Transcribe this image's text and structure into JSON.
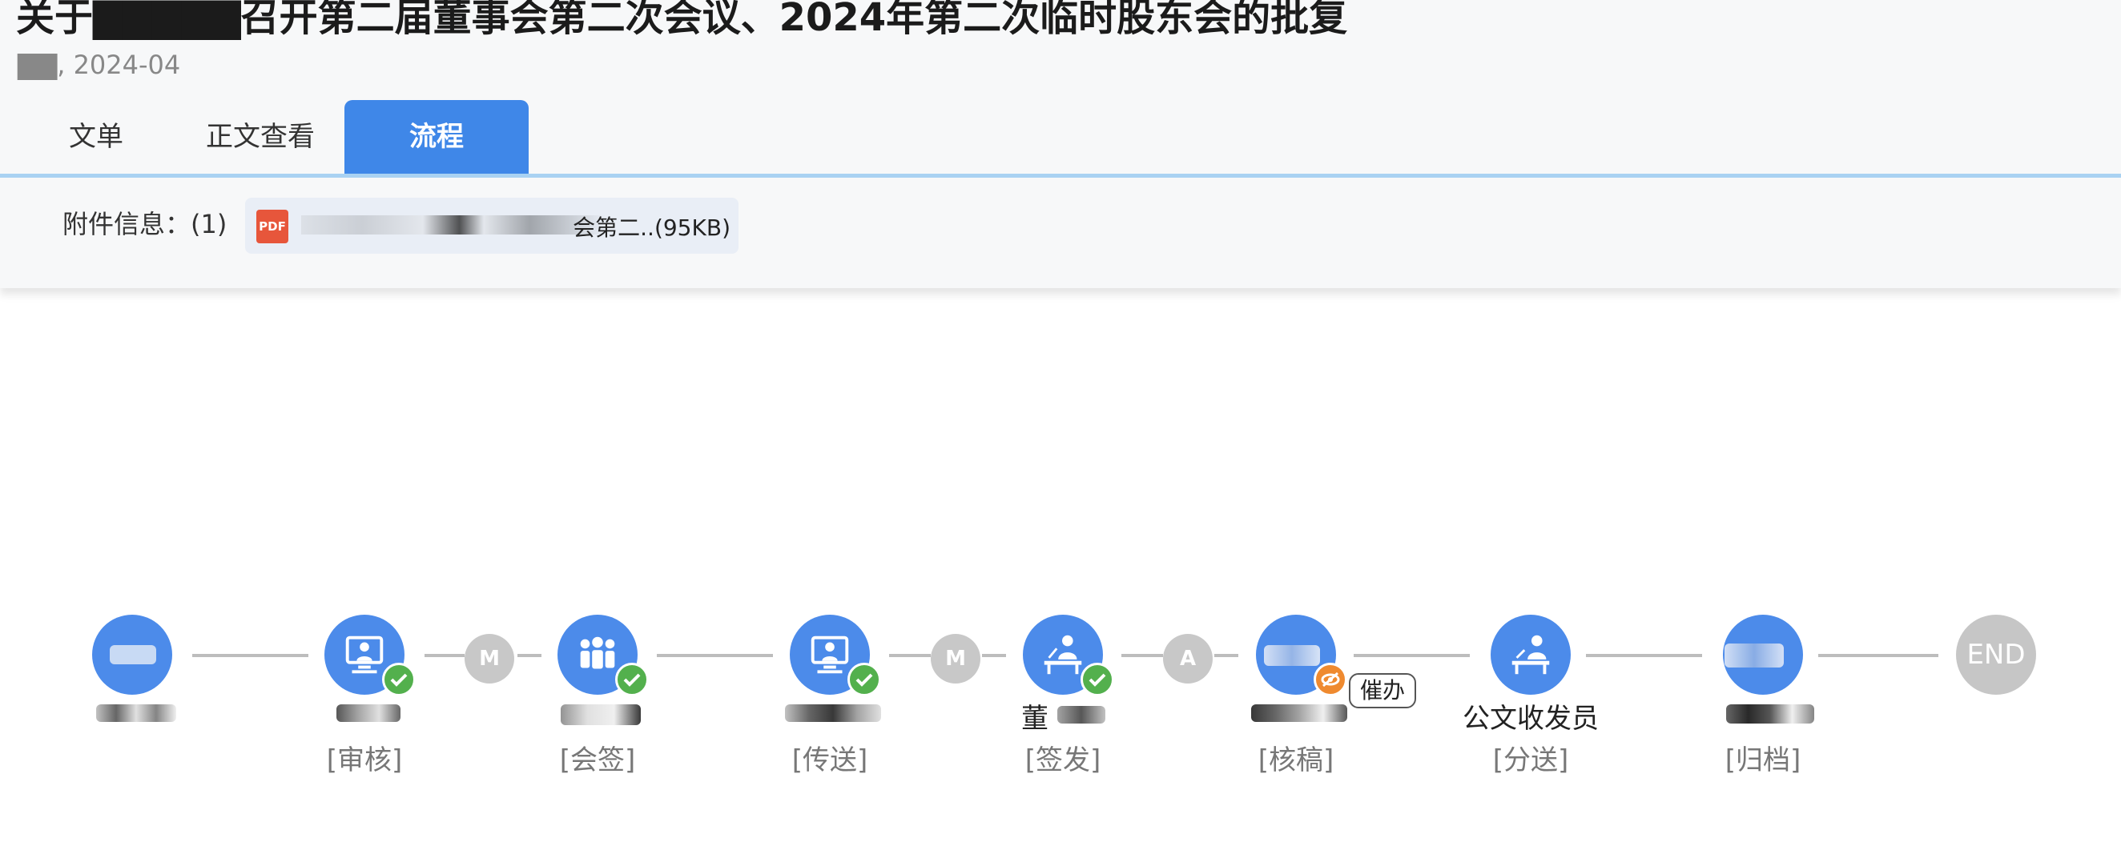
{
  "document": {
    "title": "关于▇▇▇▇▇召开第二届董事会第二次会议、2024年第二次临时股东会的批复",
    "meta": "▇▇, 2024-04"
  },
  "tabs": [
    {
      "label": "文单"
    },
    {
      "label": "正文查看"
    },
    {
      "label": "流程"
    }
  ],
  "attachments": {
    "label": "附件信息：(1)",
    "file_type_icon": "PDF",
    "file_name": "会第二..(95KB)"
  },
  "flow": {
    "end_label": "END",
    "urge_label": "催办",
    "connectors": [
      "M",
      "M",
      "A"
    ],
    "nodes": [
      {
        "name": "",
        "role": ""
      },
      {
        "name": "",
        "role": "[审核]"
      },
      {
        "name": "",
        "role": "[会签]"
      },
      {
        "name": "",
        "role": "[传送]"
      },
      {
        "name": "董",
        "role": "[签发]"
      },
      {
        "name": "",
        "role": "[核稿]"
      },
      {
        "name": "公文收发员",
        "role": "[分送]"
      },
      {
        "name": "",
        "role": "[归档]"
      }
    ]
  },
  "colors": {
    "accent": "#3f87e8",
    "node_blue": "#4c8bea",
    "done_green": "#53b04d",
    "pending_orange": "#ef8a2f",
    "disabled_gray": "#c6c6c6"
  }
}
